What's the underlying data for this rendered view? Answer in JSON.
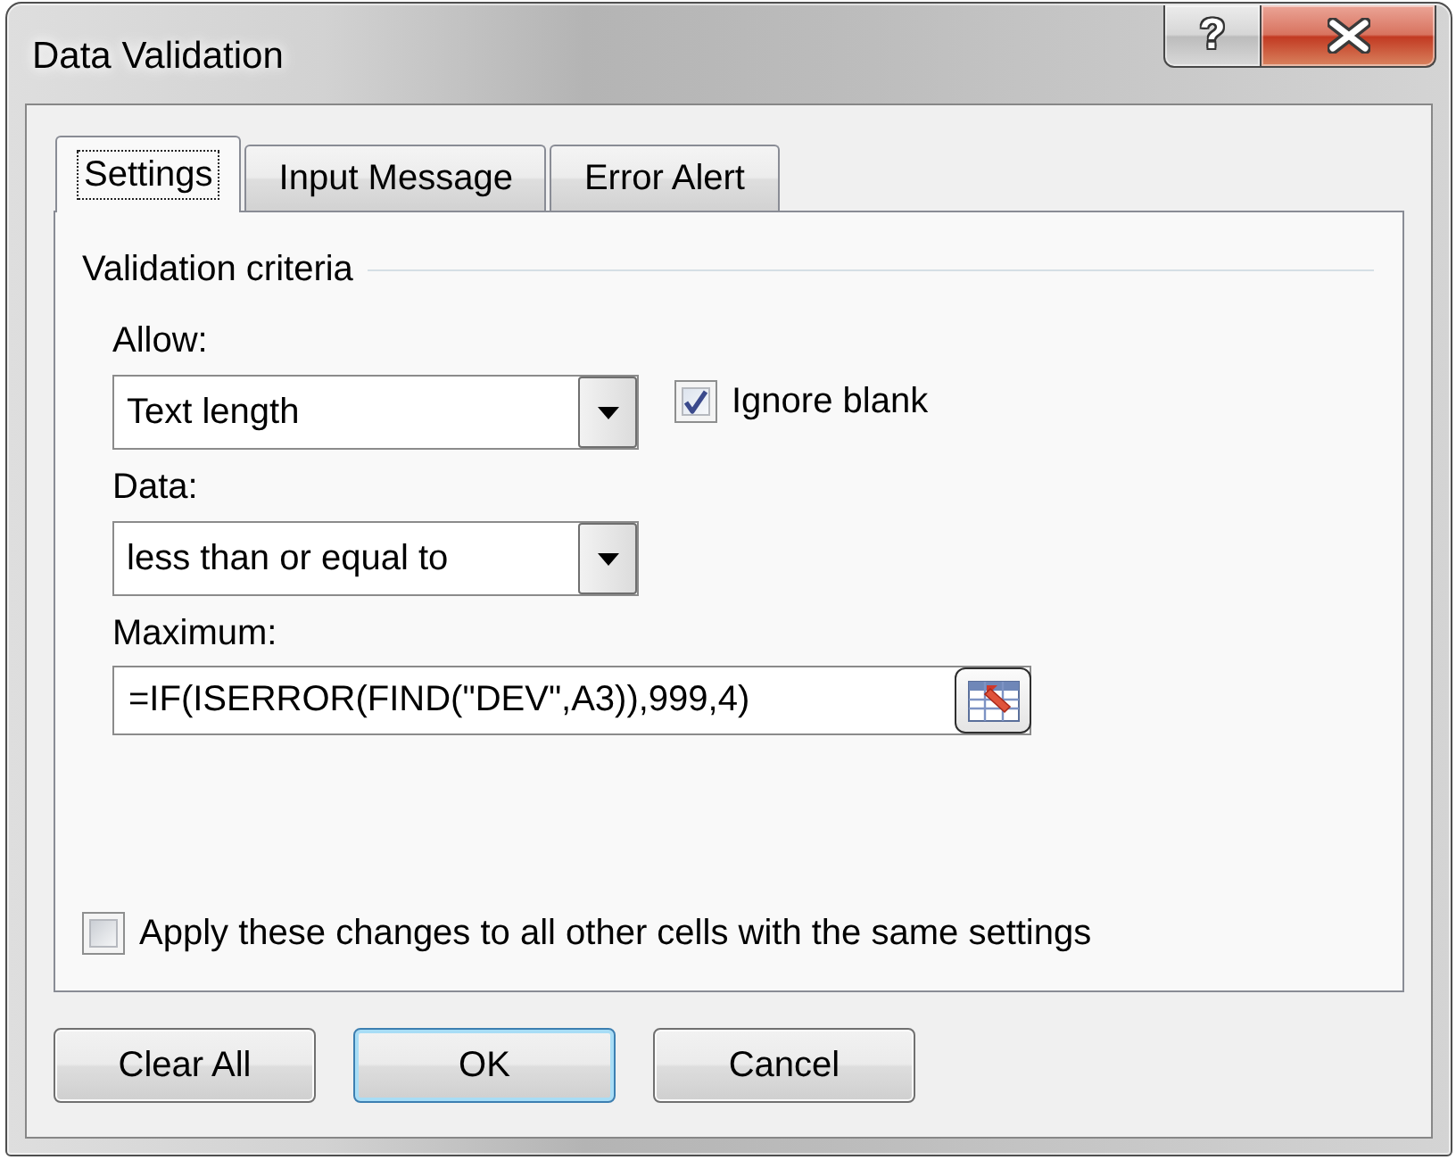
{
  "window": {
    "title": "Data Validation",
    "help_button": "?"
  },
  "tabs": [
    {
      "label": "Settings",
      "selected": true,
      "focused": true
    },
    {
      "label": "Input Message",
      "selected": false,
      "focused": false
    },
    {
      "label": "Error Alert",
      "selected": false,
      "focused": false
    }
  ],
  "settings": {
    "group_label": "Validation criteria",
    "allow": {
      "label": "Allow:",
      "value": "Text length"
    },
    "ignore_blank": {
      "label": "Ignore blank",
      "checked": true
    },
    "data": {
      "label": "Data:",
      "value": "less than or equal to"
    },
    "maximum": {
      "label": "Maximum:",
      "value": "=IF(ISERROR(FIND(\"DEV\",A3)),999,4)"
    },
    "apply_to_all": {
      "label": "Apply these changes to all other cells with the same settings",
      "checked": false
    }
  },
  "buttons": [
    {
      "label": "Clear All",
      "default": false
    },
    {
      "label": "OK",
      "default": true
    },
    {
      "label": "Cancel",
      "default": false
    }
  ]
}
